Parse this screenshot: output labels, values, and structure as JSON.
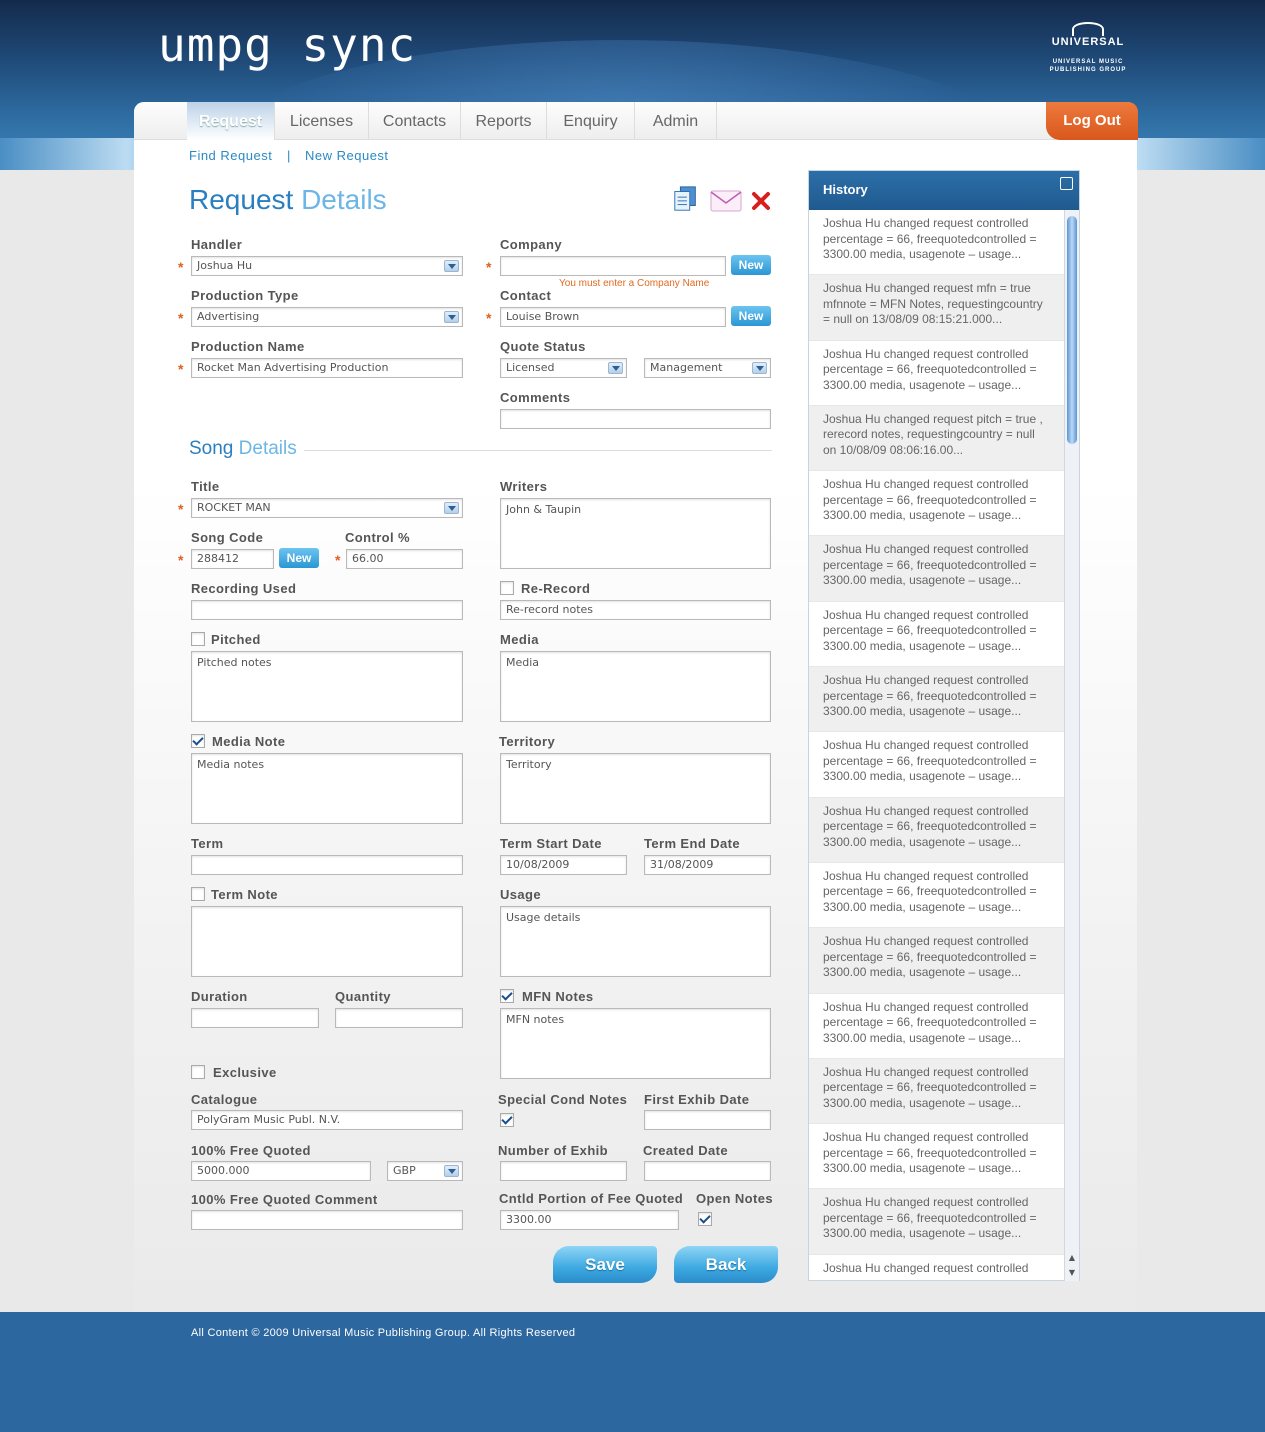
{
  "brand": {
    "app_logo": "umpg sync",
    "corp_logo_main": "UNIVERSAL",
    "corp_logo_sub": "UNIVERSAL MUSIC PUBLISHING GROUP"
  },
  "nav": {
    "tabs": [
      {
        "label": "Request"
      },
      {
        "label": "Licenses"
      },
      {
        "label": "Contacts"
      },
      {
        "label": "Reports"
      },
      {
        "label": "Enquiry"
      },
      {
        "label": "Admin"
      }
    ],
    "active_tab": "Request",
    "logout": "Log Out"
  },
  "subnav": {
    "find": "Find Request",
    "sep": "|",
    "new": "New Request"
  },
  "page_title": {
    "a": "Request",
    "b": "Details"
  },
  "request": {
    "handler_label": "Handler",
    "handler_value": "Joshua Hu",
    "company_label": "Company",
    "company_value": "",
    "company_error": "You must enter a Company Name",
    "production_type_label": "Production Type",
    "production_type_value": "Advertising",
    "contact_label": "Contact",
    "contact_value": "Louise Brown",
    "production_name_label": "Production Name",
    "production_name_value": "Rocket Man Advertising Production",
    "quote_status_label": "Quote Status",
    "quote_status_value": "Licensed",
    "quote_status_value2": "Management",
    "comments_label": "Comments",
    "comments_value": "",
    "new_label": "New"
  },
  "song_title": {
    "a": "Song",
    "b": "Details"
  },
  "song": {
    "title_label": "Title",
    "title_value": "ROCKET MAN",
    "writers_label": "Writers",
    "writers_value": "John & Taupin",
    "song_code_label": "Song Code",
    "song_code_value": "288412",
    "control_label": "Control %",
    "control_value": "66.00",
    "recording_used_label": "Recording Used",
    "recording_used_value": "",
    "rerecord_label": "Re-Record",
    "rerecord_checked": false,
    "rerecord_notes": "Re-record notes",
    "pitched_label": "Pitched",
    "pitched_checked": false,
    "pitched_notes": "Pitched notes",
    "media_label": "Media",
    "media_value": "Media",
    "media_note_label": "Media Note",
    "media_note_checked": true,
    "media_notes": "Media notes",
    "territory_label": "Territory",
    "territory_value": "Territory",
    "term_label": "Term",
    "term_value": "",
    "term_start_label": "Term Start Date",
    "term_start_value": "10/08/2009",
    "term_end_label": "Term End Date",
    "term_end_value": "31/08/2009",
    "term_note_label": "Term Note",
    "term_note_checked": false,
    "term_notes": "",
    "usage_label": "Usage",
    "usage_value": "Usage details",
    "duration_label": "Duration",
    "duration_value": "",
    "quantity_label": "Quantity",
    "quantity_value": "",
    "mfn_label": "MFN Notes",
    "mfn_checked": true,
    "mfn_value": "MFN notes",
    "exclusive_label": "Exclusive",
    "exclusive_checked": false,
    "catalogue_label": "Catalogue",
    "catalogue_value": "PolyGram Music Publ. N.V.",
    "special_cond_label": "Special Cond Notes",
    "special_cond_checked": true,
    "first_exhib_label": "First Exhib Date",
    "first_exhib_value": "",
    "free_quoted_label": "100% Free Quoted",
    "free_quoted_value": "5000.000",
    "currency_value": "GBP",
    "number_exhib_label": "Number of Exhib",
    "number_exhib_value": "",
    "created_date_label": "Created Date",
    "created_date_value": "",
    "free_quoted_comment_label": "100% Free Quoted Comment",
    "free_quoted_comment_value": "",
    "cntld_label": "Cntld Portion of Fee Quoted",
    "cntld_value": "3300.00",
    "open_notes_label": "Open Notes",
    "open_notes_checked": true
  },
  "buttons": {
    "save": "Save",
    "back": "Back"
  },
  "history": {
    "title": "History",
    "items": [
      "Joshua Hu changed request controlled percentage = 66, freequotedcontrolled = 3300.00 media, usagenote – usage...",
      "Joshua Hu changed request mfn = true mfnnote = MFN Notes, requestingcountry = null on 13/08/09 08:15:21.000...",
      "Joshua Hu changed request controlled percentage = 66, freequotedcontrolled = 3300.00 media, usagenote – usage...",
      "Joshua Hu changed request pitch = true , rerecord notes, requestingcountry = null on 10/08/09 08:06:16.00...",
      "Joshua Hu changed request controlled percentage = 66, freequotedcontrolled = 3300.00 media, usagenote – usage...",
      "Joshua Hu changed request controlled percentage = 66, freequotedcontrolled = 3300.00 media, usagenote – usage...",
      "Joshua Hu changed request controlled percentage = 66, freequotedcontrolled = 3300.00 media, usagenote – usage...",
      "Joshua Hu changed request controlled percentage = 66, freequotedcontrolled = 3300.00 media, usagenote – usage...",
      "Joshua Hu changed request controlled percentage = 66, freequotedcontrolled = 3300.00 media, usagenote – usage...",
      "Joshua Hu changed request controlled percentage = 66, freequotedcontrolled = 3300.00 media, usagenote – usage...",
      "Joshua Hu changed request controlled percentage = 66, freequotedcontrolled = 3300.00 media, usagenote – usage...",
      "Joshua Hu changed request controlled percentage = 66, freequotedcontrolled = 3300.00 media, usagenote – usage...",
      "Joshua Hu changed request controlled percentage = 66, freequotedcontrolled = 3300.00 media, usagenote – usage...",
      "Joshua Hu changed request controlled percentage = 66, freequotedcontrolled = 3300.00 media, usagenote – usage...",
      "Joshua Hu changed request controlled percentage = 66, freequotedcontrolled = 3300.00 media, usagenote – usage...",
      "Joshua Hu changed request controlled percentage = 66, freequotedcontrolled = 3300.00 media, usagenote – usage...",
      "Joshua Hu changed request controlled"
    ]
  },
  "icons": {
    "copy": "copy-document-icon",
    "email": "envelope-icon",
    "delete": "close-x-icon"
  },
  "footer": {
    "copyright": "All Content © 2009 Universal Music Publishing Group. All Rights Reserved"
  },
  "colors": {
    "accent": "#2a8ac4",
    "header_dark": "#142a4c",
    "logout": "#e0601e",
    "footer": "#2c67a0"
  }
}
